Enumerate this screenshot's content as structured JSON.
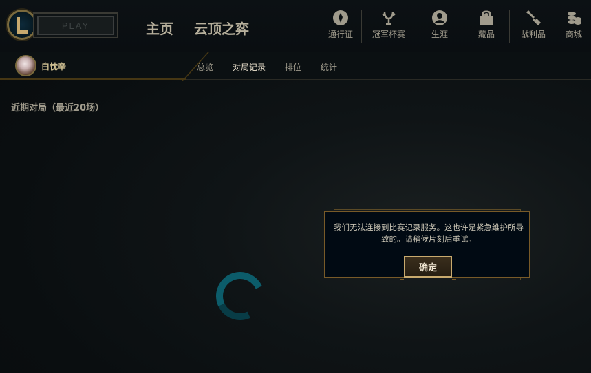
{
  "topbar": {
    "play_label": "PLAY",
    "main_nav": [
      "主页",
      "云顶之弈"
    ],
    "icon_nav": [
      {
        "label": "通行证",
        "icon": "pass-icon"
      },
      {
        "label": "冠军杯赛",
        "icon": "trophy-icon"
      },
      {
        "label": "生涯",
        "icon": "profile-icon"
      },
      {
        "label": "藏品",
        "icon": "collection-icon"
      },
      {
        "label": "战利品",
        "icon": "loot-icon"
      },
      {
        "label": "商城",
        "icon": "store-icon"
      }
    ]
  },
  "profile": {
    "username": "白忱辛"
  },
  "tabs": [
    "总览",
    "对局记录",
    "排位",
    "统计"
  ],
  "active_tab": "对局记录",
  "content": {
    "section_title": "近期对局（最近20场）"
  },
  "dialog": {
    "message": "我们无法连接到比赛记录服务。这也许是紧急维护所导致的。请稍候片刻后重试。",
    "confirm_label": "确定"
  },
  "colors": {
    "gold": "#c8aa6e",
    "dark_gold": "#785a28",
    "bg": "#010a13",
    "teal": "#0c5c6a"
  }
}
